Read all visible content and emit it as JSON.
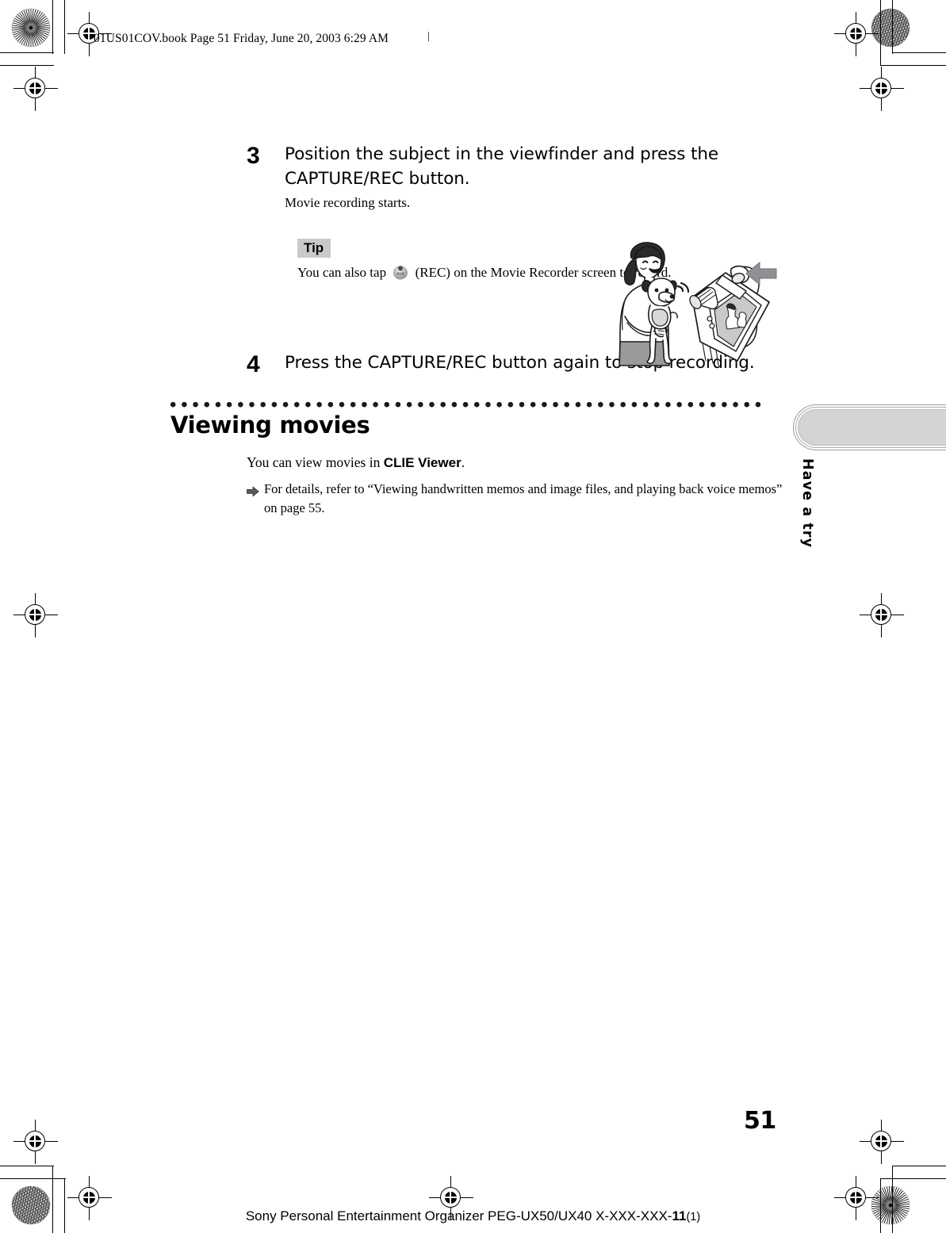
{
  "document": {
    "slugline": "01US01COV.book  Page 51  Friday, June 20, 2003  6:29 AM",
    "page_number": "51",
    "footer_main": "Sony Personal Entertainment Organizer  PEG-UX50/UX40  X-XXX-XXX-",
    "footer_bold": "11",
    "footer_suffix": "(1)"
  },
  "steps": [
    {
      "number": "3",
      "title": "Position the subject in the viewfinder and press the CAPTURE/REC button.",
      "subtext": "Movie recording starts."
    },
    {
      "number": "4",
      "title": "Press the CAPTURE/REC button again to stop recording.",
      "subtext": ""
    }
  ],
  "tip": {
    "label": "Tip",
    "text_before_icon": "You can also tap",
    "icon_name": "rec-button-icon",
    "text_after_icon": "(REC) on the Movie Recorder screen to record."
  },
  "illustration": {
    "name": "woman-holding-dog-with-clie-camera-illustration",
    "alt": "A woman holding a toy dog while a hand presses the CAPTURE/REC button on a CLIE handheld; the handheld screen shows the framed subject."
  },
  "section": {
    "title": "Viewing movies",
    "paragraph_before_bold": "You can view movies in ",
    "paragraph_bold": "CLIE Viewer",
    "paragraph_after_bold": ".",
    "reference": "For details, refer to “Viewing handwritten memos and image files, and playing back voice memos” on page 55.",
    "reference_icon_name": "right-arrow-icon"
  },
  "side_tab": {
    "label": "Have a try",
    "fill_color": "#d2d4d6",
    "border_color": "#9a9a9a"
  },
  "print_marks": {
    "registration_icon_name": "registration-target-icon",
    "rosette_icon_name": "print-rosette-icon",
    "trim_icon_name": "trim-corner-mark"
  }
}
